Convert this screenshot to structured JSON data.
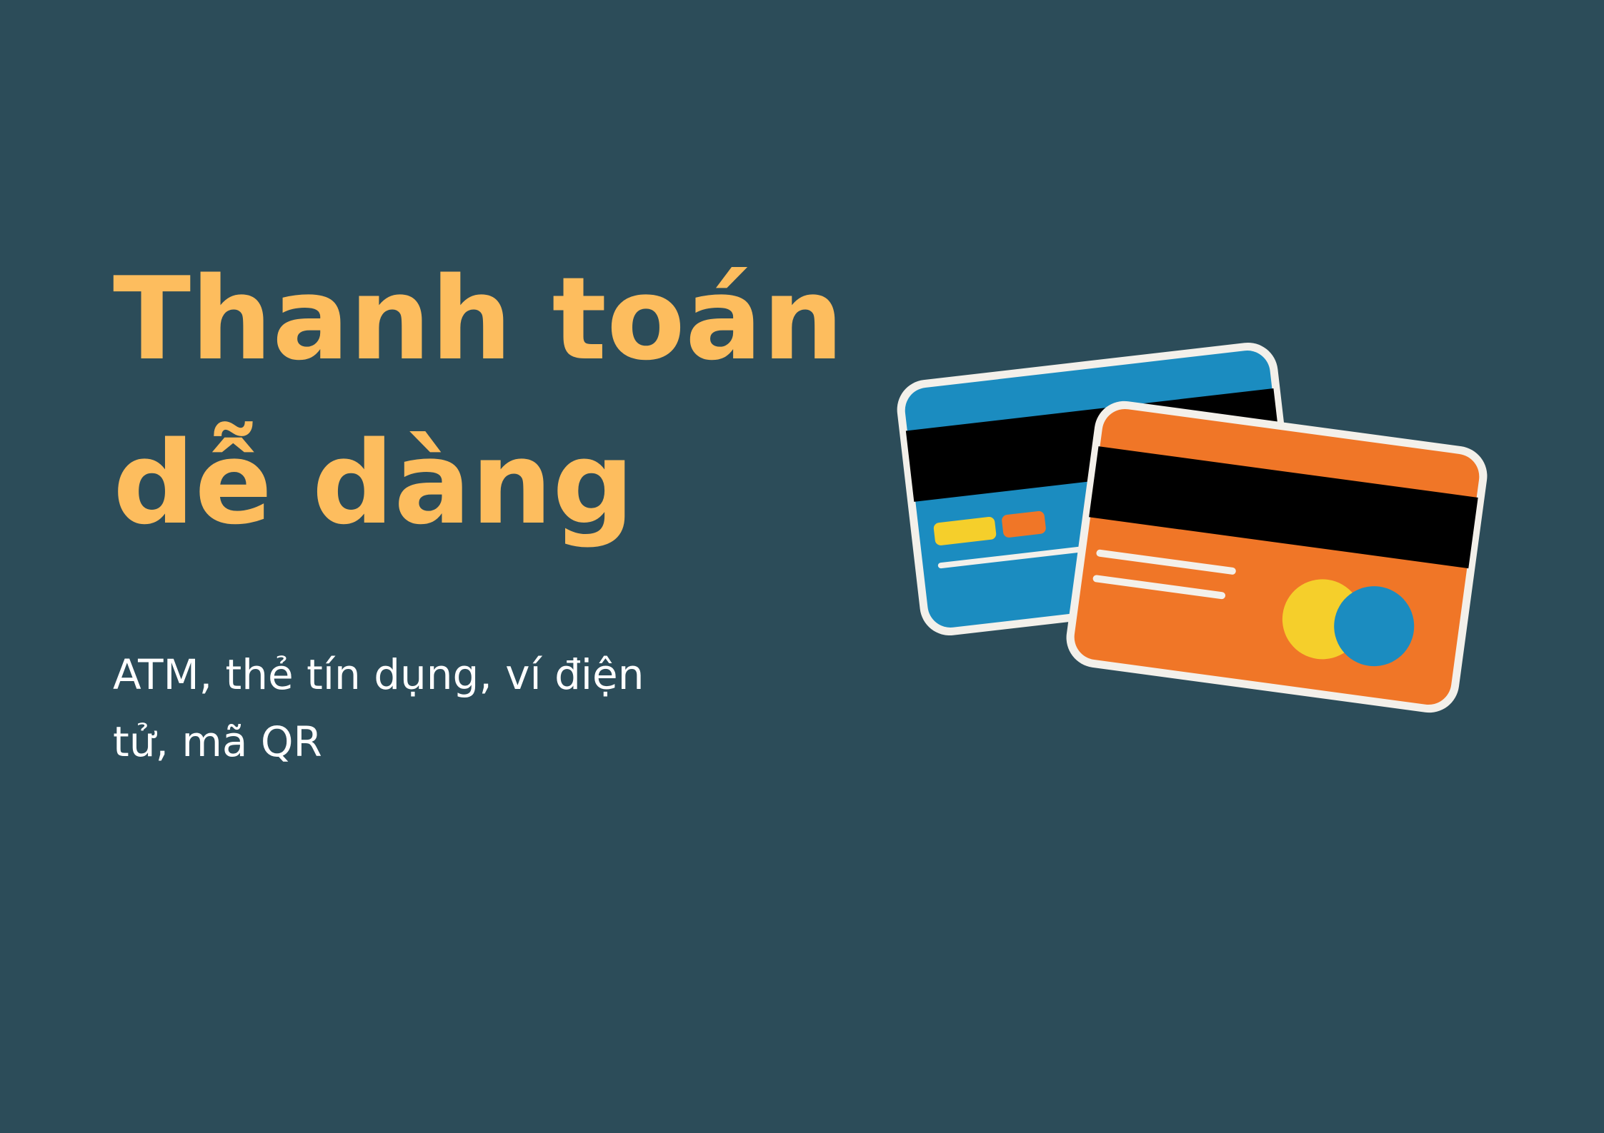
{
  "heading": {
    "line1": "Thanh toán",
    "line2": "dễ dàng"
  },
  "description": {
    "line1": "ATM, thẻ tín dụng, ví điện",
    "line2": "tử, mã QR"
  },
  "colors": {
    "background": "#2c4c59",
    "heading": "#fdbd5e",
    "text": "#ffffff",
    "card_blue": "#1b8cc0",
    "card_orange": "#f07627",
    "card_border": "#f3f0ea",
    "stripe": "#000000",
    "chip_yellow": "#f5cf2b"
  },
  "illustration": {
    "icon": "credit-cards-icon"
  }
}
